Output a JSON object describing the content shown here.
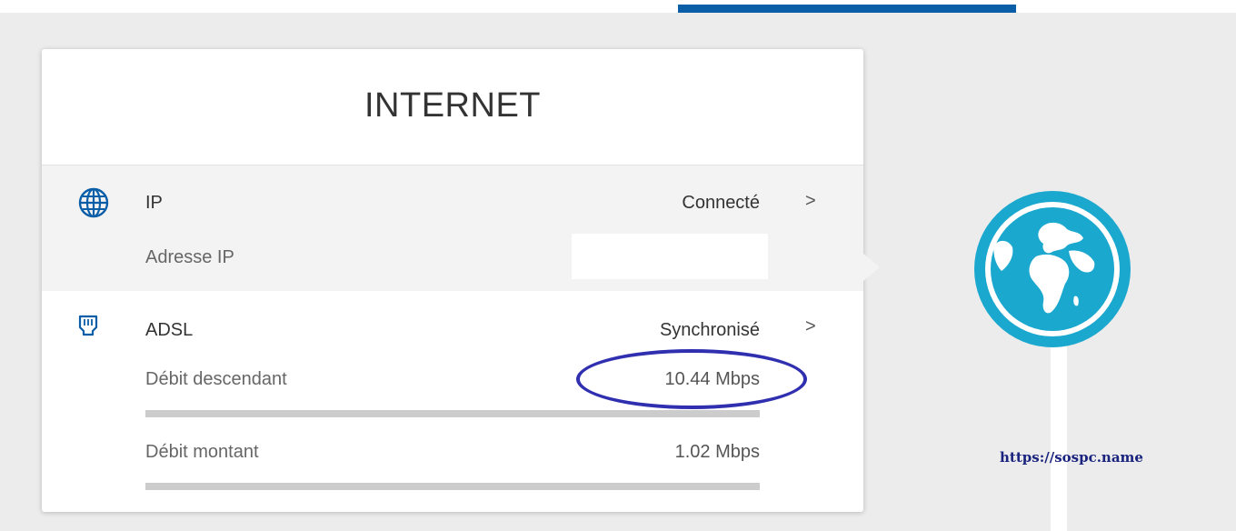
{
  "card": {
    "title": "INTERNET"
  },
  "ip": {
    "label": "IP",
    "status": "Connecté",
    "address_label": "Adresse IP",
    "icon": "globe-icon"
  },
  "adsl": {
    "label": "ADSL",
    "status": "Synchronisé",
    "icon": "adsl-port-icon",
    "down_label": "Débit descendant",
    "down_value": "10.44 Mbps",
    "up_label": "Débit montant",
    "up_value": "1.02 Mbps"
  },
  "watermark": "https://sospc.name",
  "colors": {
    "accent": "#0a5ea8",
    "globe": "#1ba8cf",
    "highlight": "#2f2fb0"
  }
}
